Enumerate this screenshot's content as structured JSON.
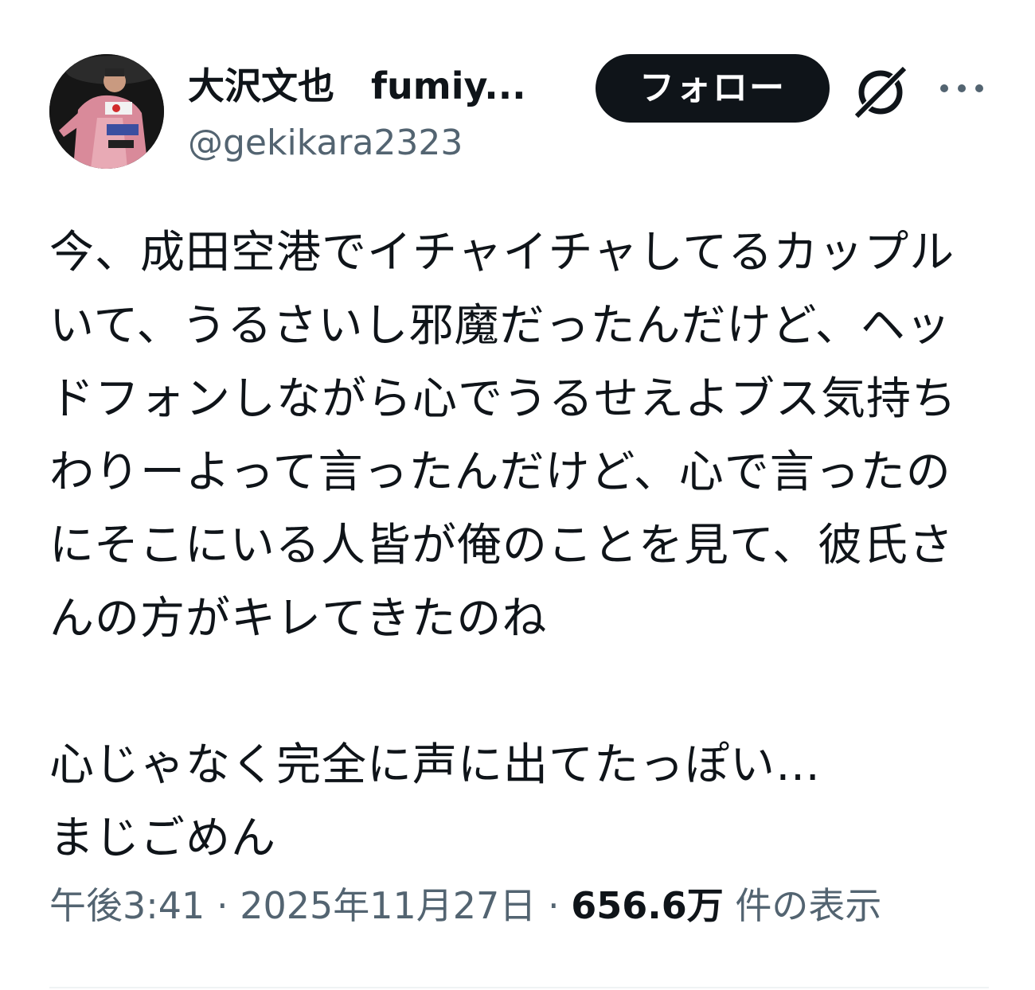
{
  "author": {
    "display_name": "大沢文也　fumiy...",
    "handle": "@gekikara2323"
  },
  "actions": {
    "follow_label": "フォロー",
    "grok_icon": "grok-icon",
    "more_icon": "more-icon"
  },
  "tweet": {
    "text": "今、成田空港でイチャイチャしてるカップルいて、うるさいし邪魔だったんだけど、ヘッドフォンしながら心でうるせえよブス気持ちわりーよって言ったんだけど、心で言ったのにそこにいる人皆が俺のことを見て、彼氏さんの方がキレてきたのね\n\n心じゃなく完全に声に出てたっぽい…\nまじごめん"
  },
  "meta": {
    "time": "午後3:41",
    "separator": "·",
    "date": "2025年11月27日",
    "views_count": "656.6万",
    "views_label": "件の表示"
  },
  "colors": {
    "text_primary": "#0f1419",
    "text_secondary": "#536471",
    "button_bg": "#0f1419",
    "button_text": "#ffffff"
  }
}
